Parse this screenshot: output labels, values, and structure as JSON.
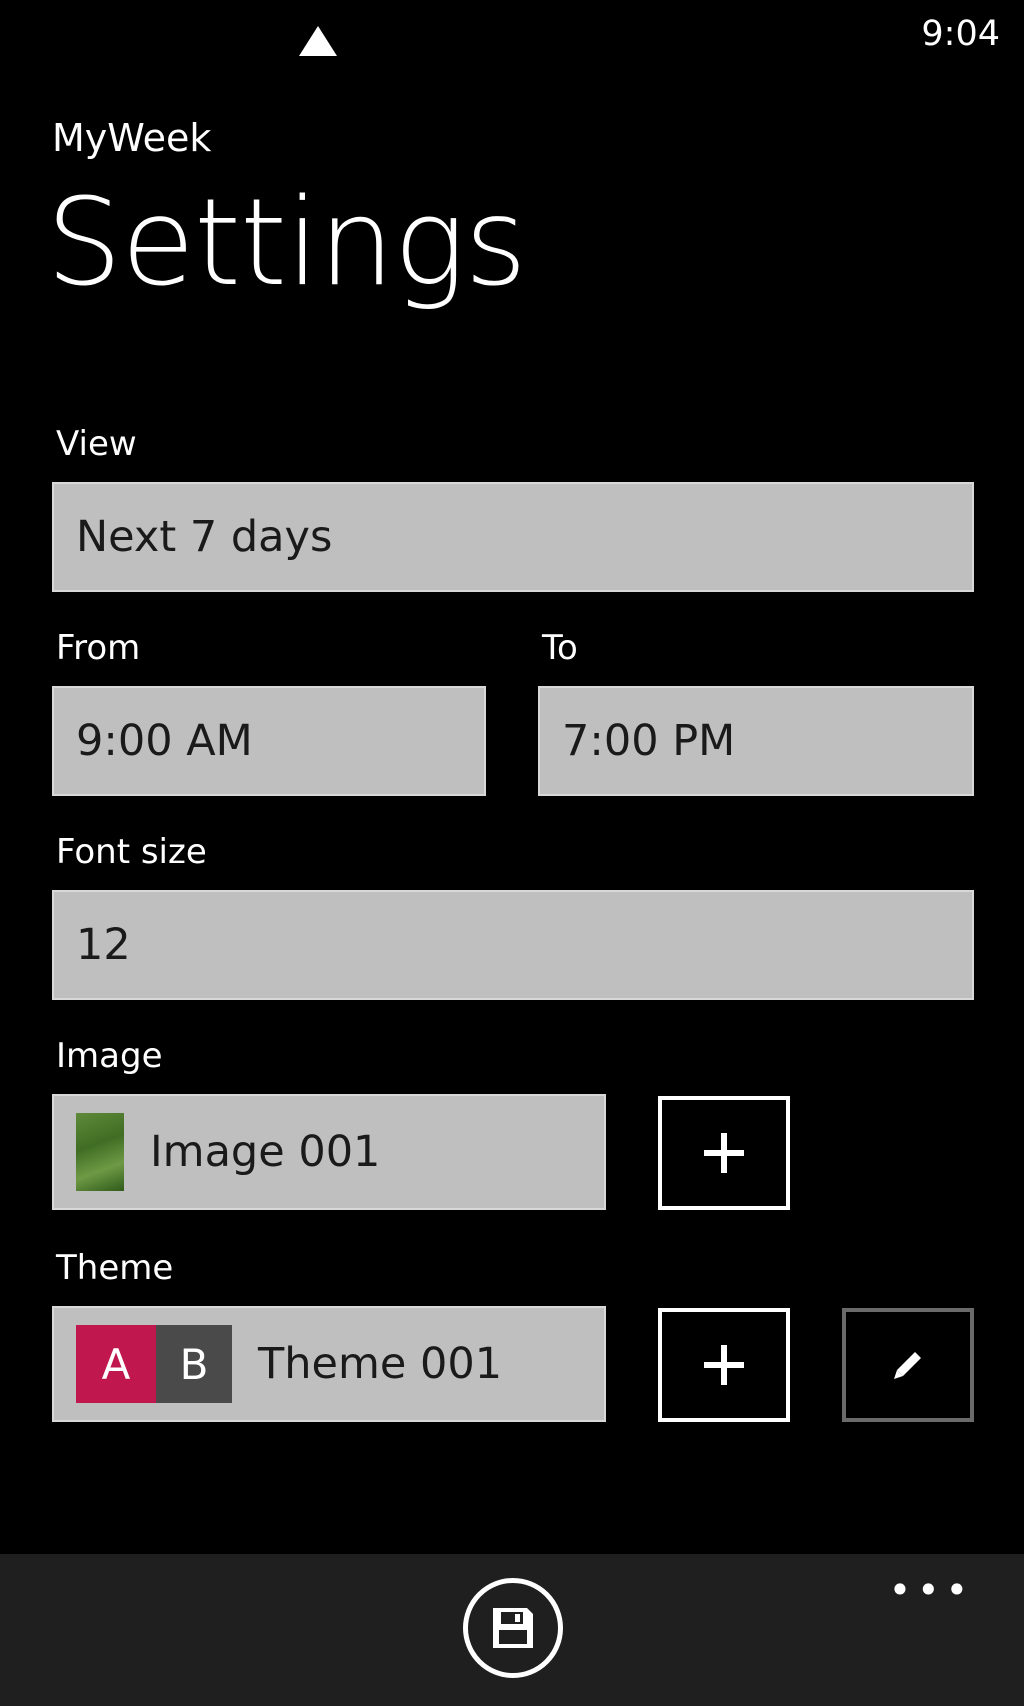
{
  "status": {
    "time": "9:04",
    "signal_icon": "signal-icon"
  },
  "header": {
    "app_title": "MyWeek",
    "page_title": "Settings"
  },
  "form": {
    "view": {
      "label": "View",
      "value": "Next 7 days"
    },
    "from": {
      "label": "From",
      "value": "9:00 AM"
    },
    "to": {
      "label": "To",
      "value": "7:00 PM"
    },
    "font_size": {
      "label": "Font size",
      "value": "12"
    },
    "image": {
      "label": "Image",
      "value": "Image 001",
      "add_icon": "plus-icon"
    },
    "theme": {
      "label": "Theme",
      "value": "Theme 001",
      "swatch_a": "A",
      "swatch_b": "B",
      "swatch_a_color": "#c0174f",
      "swatch_b_color": "#4a4a4a",
      "add_icon": "plus-icon",
      "edit_icon": "pencil-icon"
    }
  },
  "appbar": {
    "more_label": "•••",
    "save_icon": "save-icon"
  },
  "colors": {
    "background": "#000000",
    "field_bg": "#bfbfbf",
    "appbar_bg": "#1f1f1f",
    "accent": "#c0174f"
  }
}
